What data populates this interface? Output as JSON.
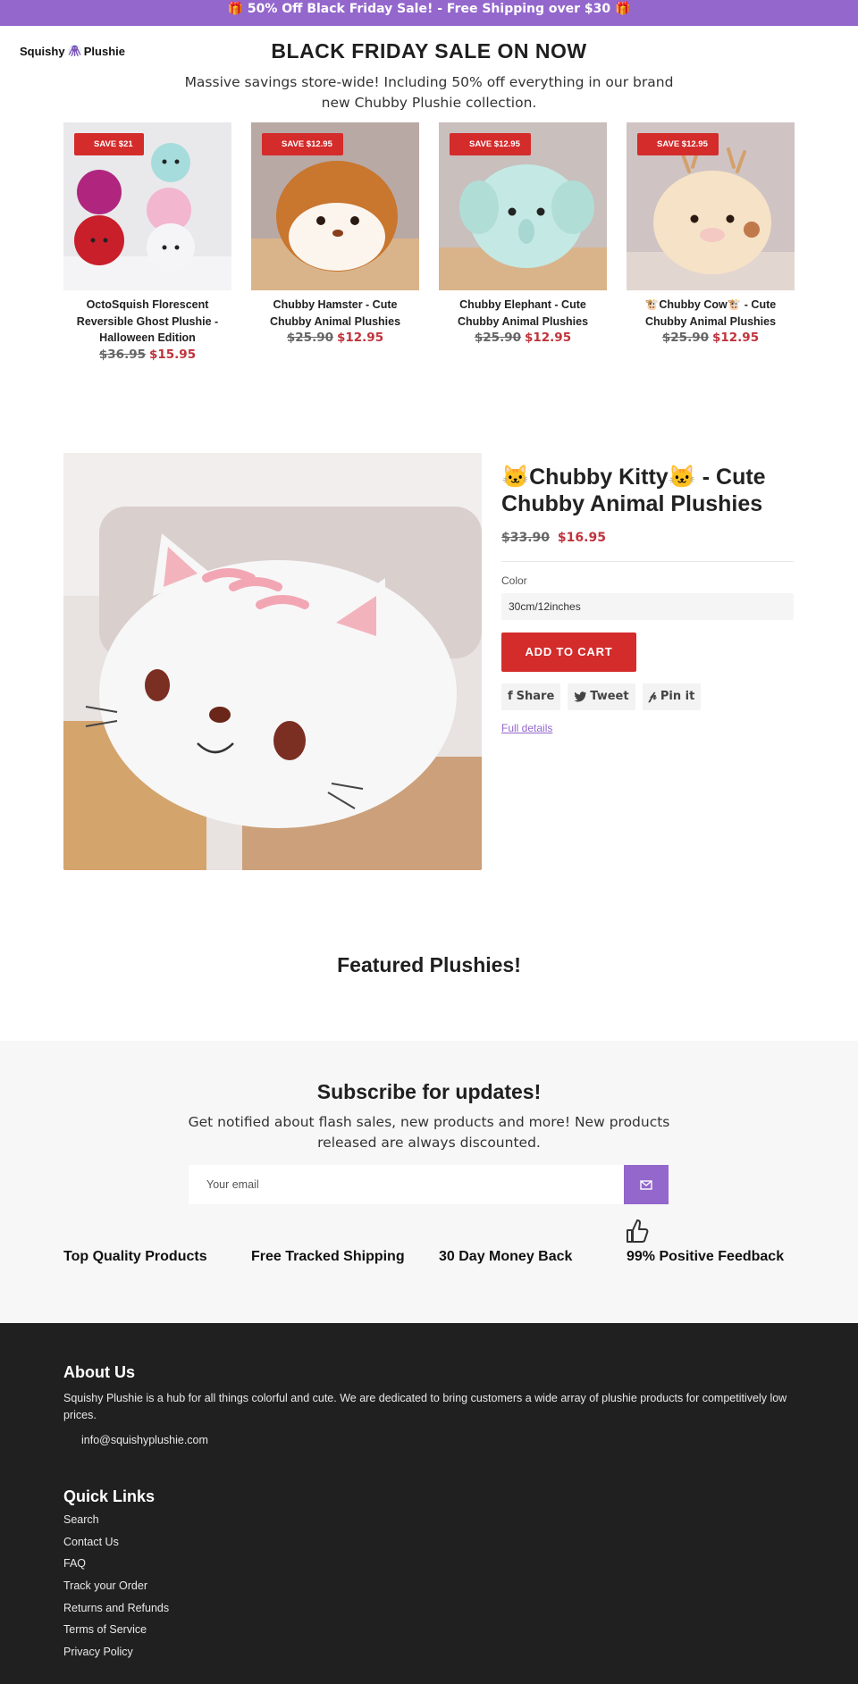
{
  "announcement": "🎁 50% Off Black Friday Sale! - Free Shipping over $30 🎁",
  "brand": {
    "word1": "Squishy",
    "word2": "Plushie"
  },
  "hero": {
    "title": "BLACK FRIDAY SALE ON NOW",
    "subtitle": "Massive savings store-wide! Including 50% off everything in our brand new Chubby Plushie collection."
  },
  "products": [
    {
      "badge": "SAVE $21",
      "title": "OctoSquish   Florescent Reversible Ghost Plushie - Halloween Edition",
      "old_price": "$36.95",
      "price": "$15.95"
    },
    {
      "badge": "SAVE $12.95",
      "title": "Chubby Hamster   - Cute Chubby Animal Plushies",
      "old_price": "$25.90",
      "price": "$12.95"
    },
    {
      "badge": "SAVE $12.95",
      "title": "Chubby Elephant   - Cute Chubby Animal Plushies",
      "old_price": "$25.90",
      "price": "$12.95"
    },
    {
      "badge": "SAVE $12.95",
      "title": "🐮Chubby Cow🐮 - Cute Chubby Animal Plushies",
      "old_price": "$25.90",
      "price": "$12.95"
    }
  ],
  "featured_product": {
    "title": "🐱Chubby Kitty🐱 - Cute Chubby Animal Plushies",
    "old_price": "$33.90",
    "price": "$16.95",
    "option_label": "Color",
    "option_value": "30cm/12inches",
    "add_to_cart": "ADD TO CART",
    "share": "Share",
    "tweet": "Tweet",
    "pin": "Pin it",
    "full_details": "Full details "
  },
  "featured_heading": "Featured Plushies!",
  "subscribe": {
    "title": "Subscribe for updates!",
    "text": "Get notified about flash sales, new products and more! New products released are always discounted.",
    "placeholder": "Your email"
  },
  "features": [
    "Top Quality Products",
    "Free Tracked Shipping",
    "30 Day Money Back",
    "99% Positive Feedback"
  ],
  "footer": {
    "about_title": "About Us",
    "about_text": "Squishy Plushie is a hub for all things colorful and cute. We are dedicated to bring customers a wide array of plushie products for competitively low prices.",
    "email": "info@squishyplushie.com",
    "links_title": "Quick Links",
    "links": [
      "Search",
      "Contact Us",
      "FAQ",
      "Track your Order",
      "Returns and Refunds",
      "Terms of Service",
      "Privacy Policy"
    ]
  },
  "colors": {
    "accent": "#9367cc",
    "sale": "#d42b2b",
    "price": "#c0333b",
    "footer_bg": "#202020"
  }
}
